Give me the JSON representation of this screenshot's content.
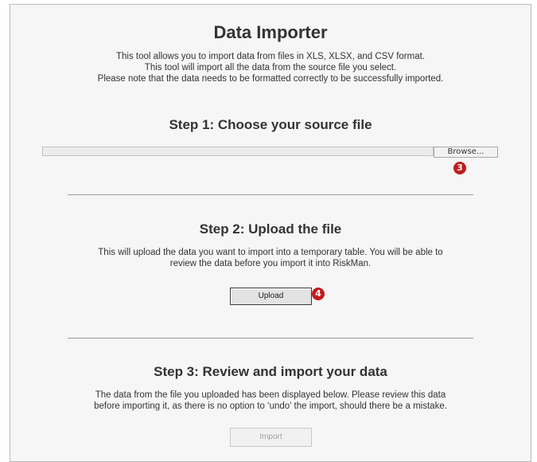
{
  "header": {
    "title": "Data Importer",
    "intro_lines": [
      "This tool allows you to import data from files in XLS, XLSX, and CSV format.",
      "This tool will import all the data from the source file you select.",
      "Please note that the data needs to be formatted correctly to be successfully imported."
    ]
  },
  "step1": {
    "title": "Step 1: Choose your source file",
    "browse_label": "Browse...",
    "badge": "3"
  },
  "step2": {
    "title": "Step 2: Upload the file",
    "desc_lines": [
      "This will upload the data you want to import into a temporary table. You will be able to",
      "review the data before you import it into RiskMan."
    ],
    "upload_label": "Upload",
    "badge": "4"
  },
  "step3": {
    "title": "Step 3: Review and import your data",
    "desc_lines": [
      "The data from the file you uploaded has been displayed below. Please review this data",
      "before importing it, as there is no option to ‘undo’ the import, should there be a mistake."
    ],
    "import_label": "Import"
  },
  "colors": {
    "badge": "#c21b1b",
    "panel_background": "#f6f6f6"
  }
}
